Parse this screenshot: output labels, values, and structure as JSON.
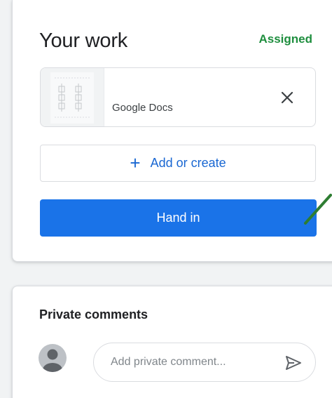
{
  "work": {
    "title": "Your work",
    "status": "Assigned",
    "attachment": {
      "label": "Google Docs",
      "thumbnail_icon": "document-thumbnail",
      "remove_icon": "close-icon"
    },
    "add_button": {
      "icon": "plus-icon",
      "label": "Add or create"
    },
    "hand_in_label": "Hand in"
  },
  "comments": {
    "title": "Private comments",
    "avatar_icon": "user-avatar-icon",
    "placeholder": "Add private comment...",
    "send_icon": "send-icon"
  },
  "colors": {
    "accent_blue": "#1a73e8",
    "link_blue": "#1967d2",
    "status_green": "#1e8e3e",
    "annotation_arrow": "#2e7d32"
  }
}
